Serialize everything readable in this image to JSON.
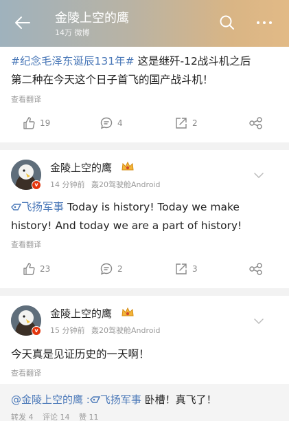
{
  "header": {
    "title": "金陵上空的鹰",
    "subtitle": "14万 微博"
  },
  "post1": {
    "text_hashtag": "#纪念毛泽东诞辰131年#",
    "text_line1_rest": " 这是继歼-12战斗机之后",
    "text_line2": "第二种在今天这个日子首飞的国产战斗机！",
    "translate": "查看翻译",
    "likes": "19",
    "comments": "4",
    "reposts": "2"
  },
  "comment1": {
    "user_name": "金陵上空的鹰",
    "time": "14 分钟前",
    "device": "轰20驾驶舱Android",
    "topic": "飞扬军事",
    "text_line1_rest": " Today is history!  Today we make",
    "text_line2": "history!  And today we are a part of history!",
    "translate": "查看翻译",
    "likes": "23",
    "comments": "2",
    "reposts": "3"
  },
  "comment2": {
    "user_name": "金陵上空的鹰",
    "time": "15 分钟前",
    "device": "轰20驾驶舱Android",
    "text": "今天真是见证历史的一天啊！",
    "translate": "查看翻译"
  },
  "repost": {
    "mention": "@金陵上空的鹰",
    "separator": " :",
    "topic": "飞扬军事",
    "text": " 卧槽！真飞了！",
    "forward_label": "转发 4",
    "comment_label": "评论 14",
    "like_label": "赞 11"
  },
  "colors": {
    "link": "#4a78b8",
    "badge": "#e3350d",
    "divider": "#f2f2f2"
  },
  "icons": [
    "back-arrow-icon",
    "search-icon",
    "more-icon",
    "like-icon",
    "comment-icon",
    "repost-icon",
    "share-icon",
    "crown-icon",
    "verified-icon",
    "chevron-down-icon",
    "topic-icon"
  ]
}
